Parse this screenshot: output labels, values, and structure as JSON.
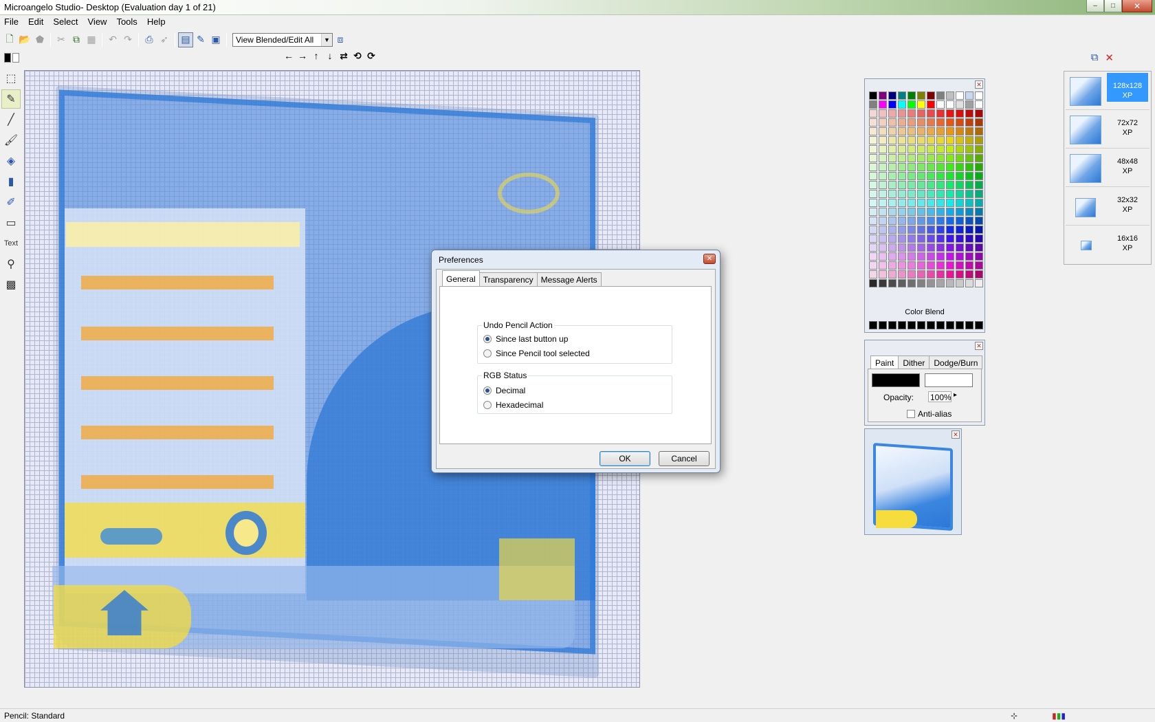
{
  "window": {
    "title": "Microangelo Studio- Desktop  (Evaluation day 1 of 21)",
    "buttons": {
      "minimize": "–",
      "maximize": "□",
      "close": "✕"
    }
  },
  "menu": [
    "File",
    "Edit",
    "Select",
    "View",
    "Tools",
    "Help"
  ],
  "toolbar": {
    "view_mode": "View Blended/Edit All"
  },
  "dialog": {
    "title": "Preferences",
    "close": "✕",
    "tabs": [
      "General",
      "Transparency",
      "Message Alerts"
    ],
    "active_tab": "General",
    "undo_group": {
      "label": "Undo Pencil Action",
      "options": [
        "Since last button up",
        "Since Pencil tool selected"
      ],
      "selected": 0
    },
    "rgb_group": {
      "label": "RGB Status",
      "options": [
        "Decimal",
        "Hexadecimal"
      ],
      "selected": 0
    },
    "ok": "OK",
    "cancel": "Cancel"
  },
  "palette": {
    "color_blend": "Color Blend"
  },
  "paint_panel": {
    "tabs": [
      "Paint",
      "Dither",
      "Dodge/Burn"
    ],
    "opacity_label": "Opacity:",
    "opacity_value": "100%",
    "antialias": "Anti-alias"
  },
  "sizes": [
    {
      "size": "128x128",
      "format": "XP",
      "active": true
    },
    {
      "size": "72x72",
      "format": "XP",
      "active": false
    },
    {
      "size": "48x48",
      "format": "XP",
      "active": false
    },
    {
      "size": "32x32",
      "format": "XP",
      "active": false
    },
    {
      "size": "16x16",
      "format": "XP",
      "active": false
    }
  ],
  "status": {
    "text": "Pencil: Standard"
  },
  "colors": {
    "accent": "#3399ff",
    "icon_blue": "#2d78d6",
    "icon_yellow": "#f6dc3c",
    "icon_orange": "#f2a83a"
  }
}
